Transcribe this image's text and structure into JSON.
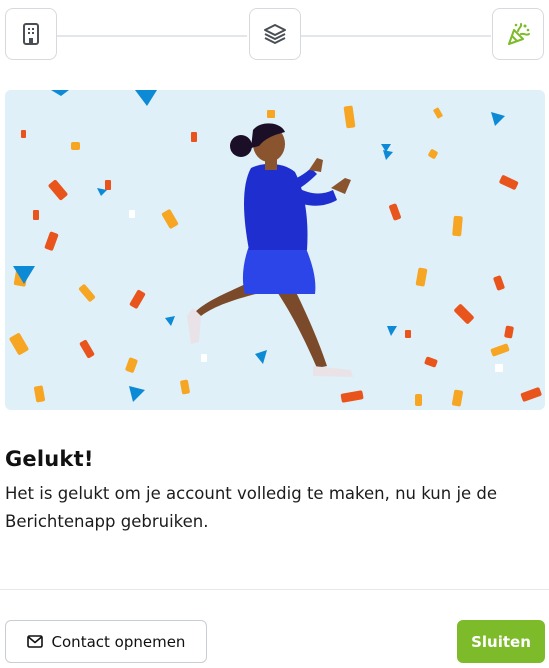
{
  "stepper": {
    "steps": [
      {
        "icon": "building-icon",
        "state": "done"
      },
      {
        "icon": "layers-icon",
        "state": "done"
      },
      {
        "icon": "party-popper-icon",
        "state": "active"
      }
    ],
    "accent_color": "#7dbb2a"
  },
  "illustration": {
    "icon": "celebration-illustration",
    "background_color": "#dff0f8"
  },
  "content": {
    "title": "Gelukt!",
    "message": "Het is gelukt om je account volledig te maken, nu kun je de Berichtenapp gebruiken."
  },
  "footer": {
    "contact_label": "Contact opnemen",
    "contact_icon": "mail-icon",
    "close_label": "Sluiten",
    "close_color": "#7dbb2a"
  }
}
